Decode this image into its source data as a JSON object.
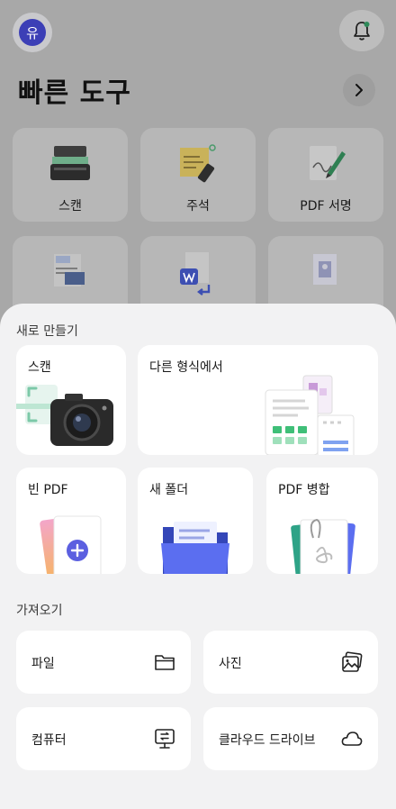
{
  "header": {
    "avatar_letter": "유",
    "avatar_color": "#3c3fb6"
  },
  "quick_tools": {
    "title": "빠른 도구",
    "items": [
      {
        "label": "스캔",
        "icon": "scanner-icon"
      },
      {
        "label": "주석",
        "icon": "sticky-note-highlighter-icon"
      },
      {
        "label": "PDF 서명",
        "icon": "signature-pen-icon"
      },
      {
        "label": "",
        "icon": "image-to-text-icon"
      },
      {
        "label": "",
        "icon": "word-convert-icon"
      },
      {
        "label": "",
        "icon": "image-file-icon"
      }
    ]
  },
  "sheet": {
    "create_title": "새로 만들기",
    "create_items": [
      {
        "label": "스캔",
        "icon": "camera-icon"
      },
      {
        "label": "다른 형식에서",
        "icon": "file-formats-icon"
      },
      {
        "label": "빈 PDF",
        "icon": "blank-pdf-icon"
      },
      {
        "label": "새 폴더",
        "icon": "new-folder-icon"
      },
      {
        "label": "PDF 병합",
        "icon": "merge-pdf-icon"
      }
    ],
    "import_title": "가져오기",
    "import_items": [
      {
        "label": "파일",
        "icon": "folder-icon"
      },
      {
        "label": "사진",
        "icon": "photo-icon"
      },
      {
        "label": "컴퓨터",
        "icon": "computer-transfer-icon"
      },
      {
        "label": "클라우드 드라이브",
        "icon": "cloud-icon"
      }
    ]
  },
  "colors": {
    "accent": "#5b5fe0",
    "sheet_bg": "#f2f2f3",
    "card_bg": "#ffffff"
  }
}
